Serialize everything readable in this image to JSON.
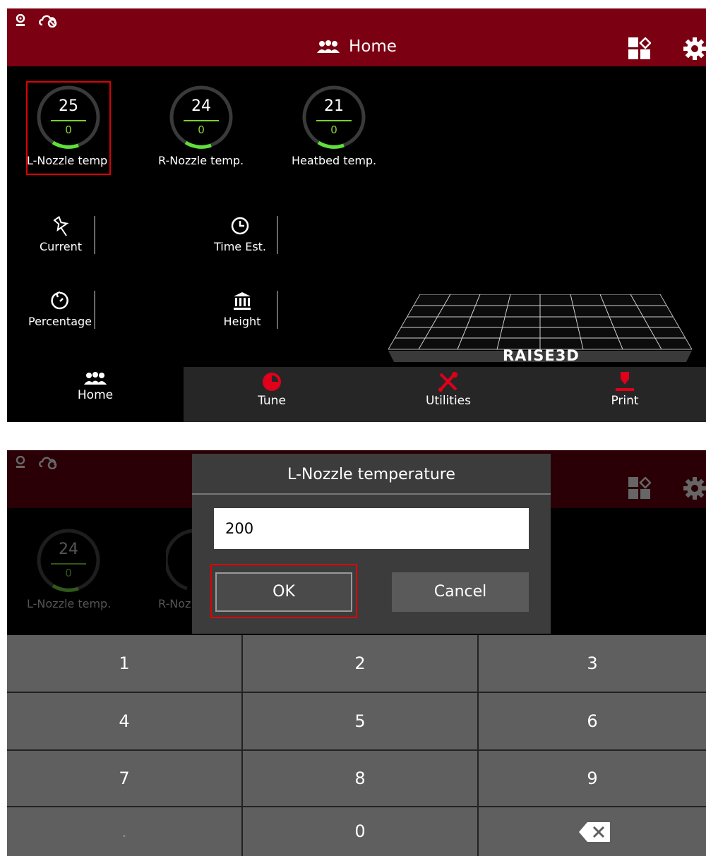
{
  "home_screen": {
    "header": {
      "title": "Home"
    },
    "gauges": [
      {
        "current": "25",
        "target": "0",
        "label": "L-Nozzle temp"
      },
      {
        "current": "24",
        "target": "0",
        "label": "R-Nozzle temp."
      },
      {
        "current": "21",
        "target": "0",
        "label": "Heatbed temp."
      }
    ],
    "stats": {
      "current": "Current",
      "time_est": "Time Est.",
      "percentage": "Percentage",
      "height": "Height"
    },
    "brand": "RAISE3D",
    "nav": {
      "home": "Home",
      "tune": "Tune",
      "utilities": "Utilities",
      "print": "Print"
    },
    "colors": {
      "header": "#7a0012",
      "accent": "#e0001b",
      "gauge_green": "#7dcf2a"
    }
  },
  "dialog_screen": {
    "background_gauge": {
      "current": "24",
      "target": "0",
      "label": "L-Nozzle temp.",
      "label2": "R-Noz"
    },
    "dialog": {
      "title": "L-Nozzle temperature",
      "input_value": "200",
      "ok_label": "OK",
      "cancel_label": "Cancel"
    },
    "keypad": {
      "keys": [
        "1",
        "2",
        "3",
        "4",
        "5",
        "6",
        "7",
        "8",
        "9",
        ".",
        "0"
      ],
      "backspace_icon": "backspace-icon"
    }
  }
}
